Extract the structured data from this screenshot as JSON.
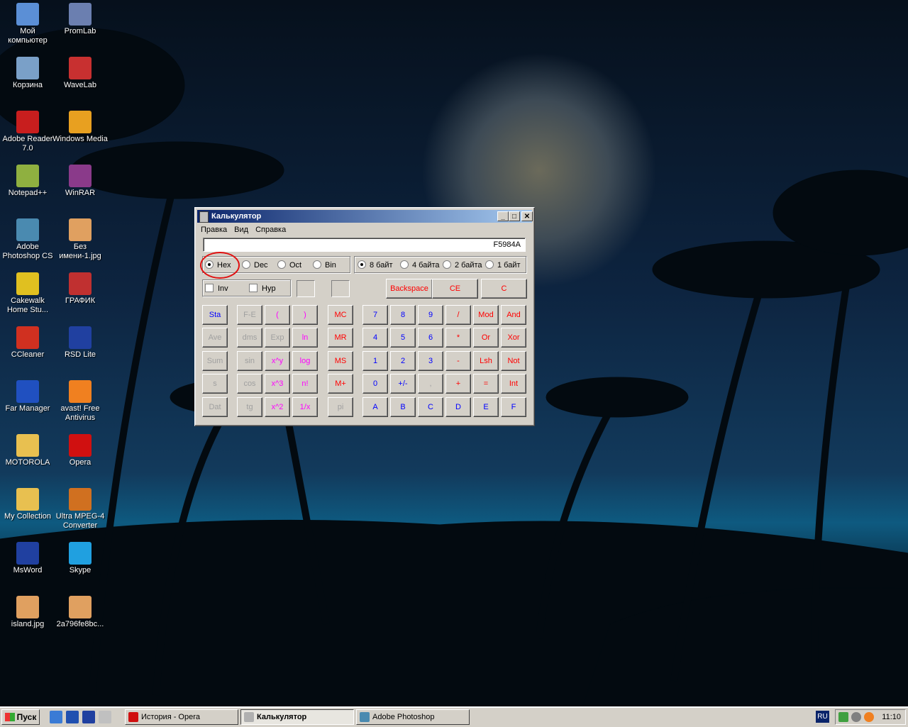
{
  "desktop": {
    "icons": [
      {
        "label": "Мой компьютер",
        "icon": "my-computer-icon",
        "color": "#5b8fd6"
      },
      {
        "label": "PromLab",
        "icon": "promlab-icon",
        "color": "#6b7fb0"
      },
      {
        "label": "Корзина",
        "icon": "recycle-bin-icon",
        "color": "#7aa0c8"
      },
      {
        "label": "WaveLab",
        "icon": "wavelab-icon",
        "color": "#c83030"
      },
      {
        "label": "Adobe Reader 7.0",
        "icon": "adobe-reader-icon",
        "color": "#c81e1e"
      },
      {
        "label": "Windows Media",
        "icon": "windows-media-icon",
        "color": "#e8a020"
      },
      {
        "label": "Notepad++",
        "icon": "notepadpp-icon",
        "color": "#8fb040"
      },
      {
        "label": "WinRAR",
        "icon": "winrar-icon",
        "color": "#8a3a8a"
      },
      {
        "label": "Adobe Photoshop CS",
        "icon": "photoshop-icon",
        "color": "#4a8ab0"
      },
      {
        "label": "Без имени-1.jpg",
        "icon": "jpg-file-icon",
        "color": "#e0a060"
      },
      {
        "label": "Cakewalk Home Stu...",
        "icon": "cakewalk-icon",
        "color": "#e0c020"
      },
      {
        "label": "ГРАФИК",
        "icon": "ms-graph-icon",
        "color": "#c03030"
      },
      {
        "label": "CCleaner",
        "icon": "ccleaner-icon",
        "color": "#d03020"
      },
      {
        "label": "RSD Lite",
        "icon": "rsd-lite-icon",
        "color": "#2040a0"
      },
      {
        "label": "Far Manager",
        "icon": "far-manager-icon",
        "color": "#2050c0"
      },
      {
        "label": "avast! Free Antivirus",
        "icon": "avast-icon",
        "color": "#f08020"
      },
      {
        "label": "MOTOROLA",
        "icon": "folder-icon",
        "color": "#e8c050"
      },
      {
        "label": "Opera",
        "icon": "opera-icon",
        "color": "#d01010"
      },
      {
        "label": "My Collection",
        "icon": "folder-icon",
        "color": "#e8c050"
      },
      {
        "label": "Ultra MPEG-4 Converter",
        "icon": "ultra-mpeg-icon",
        "color": "#d07020"
      },
      {
        "label": "MsWord",
        "icon": "msword-icon",
        "color": "#2040a0"
      },
      {
        "label": "Skype",
        "icon": "skype-icon",
        "color": "#20a0e0"
      },
      {
        "label": "island.jpg",
        "icon": "jpg-file-icon",
        "color": "#e0a060"
      },
      {
        "label": "2a796fe8bc...",
        "icon": "jpg-file-icon",
        "color": "#e0a060"
      }
    ]
  },
  "calculator": {
    "title": "Калькулятор",
    "menu": [
      "Правка",
      "Вид",
      "Справка"
    ],
    "display": "F5984A",
    "bases": [
      {
        "label": "Hex",
        "selected": true
      },
      {
        "label": "Dec",
        "selected": false
      },
      {
        "label": "Oct",
        "selected": false
      },
      {
        "label": "Bin",
        "selected": false
      }
    ],
    "sizes": [
      {
        "label": "8 байт",
        "selected": true
      },
      {
        "label": "4 байта",
        "selected": false
      },
      {
        "label": "2 байта",
        "selected": false
      },
      {
        "label": "1 байт",
        "selected": false
      }
    ],
    "checkboxes": [
      {
        "label": "Inv",
        "checked": false
      },
      {
        "label": "Hyp",
        "checked": false
      }
    ],
    "top_buttons": [
      {
        "label": "Backspace",
        "color": "red"
      },
      {
        "label": "CE",
        "color": "red"
      },
      {
        "label": "C",
        "color": "red"
      }
    ],
    "stat_column": [
      {
        "label": "Sta",
        "color": "blue"
      },
      {
        "label": "Ave",
        "color": "gray"
      },
      {
        "label": "Sum",
        "color": "gray"
      },
      {
        "label": "s",
        "color": "gray"
      },
      {
        "label": "Dat",
        "color": "gray"
      }
    ],
    "sci_col1": [
      {
        "label": "F-E",
        "color": "gray"
      },
      {
        "label": "dms",
        "color": "gray"
      },
      {
        "label": "sin",
        "color": "gray"
      },
      {
        "label": "cos",
        "color": "gray"
      },
      {
        "label": "tg",
        "color": "gray"
      }
    ],
    "sci_col2": [
      {
        "label": "(",
        "color": "mag"
      },
      {
        "label": "Exp",
        "color": "gray"
      },
      {
        "label": "x^y",
        "color": "mag"
      },
      {
        "label": "x^3",
        "color": "mag"
      },
      {
        "label": "x^2",
        "color": "mag"
      }
    ],
    "sci_col3": [
      {
        "label": ")",
        "color": "mag"
      },
      {
        "label": "ln",
        "color": "mag"
      },
      {
        "label": "log",
        "color": "mag"
      },
      {
        "label": "n!",
        "color": "mag"
      },
      {
        "label": "1/x",
        "color": "mag"
      }
    ],
    "memory": [
      {
        "label": "MC",
        "color": "red"
      },
      {
        "label": "MR",
        "color": "red"
      },
      {
        "label": "MS",
        "color": "red"
      },
      {
        "label": "M+",
        "color": "red"
      },
      {
        "label": "pi",
        "color": "gray"
      }
    ],
    "keypad": [
      [
        {
          "label": "7",
          "color": "blue"
        },
        {
          "label": "8",
          "color": "blue"
        },
        {
          "label": "9",
          "color": "blue"
        },
        {
          "label": "/",
          "color": "red"
        },
        {
          "label": "Mod",
          "color": "red"
        },
        {
          "label": "And",
          "color": "red"
        }
      ],
      [
        {
          "label": "4",
          "color": "blue"
        },
        {
          "label": "5",
          "color": "blue"
        },
        {
          "label": "6",
          "color": "blue"
        },
        {
          "label": "*",
          "color": "red"
        },
        {
          "label": "Or",
          "color": "red"
        },
        {
          "label": "Xor",
          "color": "red"
        }
      ],
      [
        {
          "label": "1",
          "color": "blue"
        },
        {
          "label": "2",
          "color": "blue"
        },
        {
          "label": "3",
          "color": "blue"
        },
        {
          "label": "-",
          "color": "red"
        },
        {
          "label": "Lsh",
          "color": "red"
        },
        {
          "label": "Not",
          "color": "red"
        }
      ],
      [
        {
          "label": "0",
          "color": "blue"
        },
        {
          "label": "+/-",
          "color": "blue"
        },
        {
          "label": ",",
          "color": "gray"
        },
        {
          "label": "+",
          "color": "red"
        },
        {
          "label": "=",
          "color": "red"
        },
        {
          "label": "Int",
          "color": "red"
        }
      ],
      [
        {
          "label": "A",
          "color": "blue"
        },
        {
          "label": "B",
          "color": "blue"
        },
        {
          "label": "C",
          "color": "blue"
        },
        {
          "label": "D",
          "color": "blue"
        },
        {
          "label": "E",
          "color": "blue"
        },
        {
          "label": "F",
          "color": "blue"
        }
      ]
    ]
  },
  "taskbar": {
    "start_label": "Пуск",
    "tasks": [
      {
        "label": "История - Opera",
        "icon": "opera-icon",
        "active": false
      },
      {
        "label": "Калькулятор",
        "icon": "calculator-icon",
        "active": true
      },
      {
        "label": "Adobe Photoshop",
        "icon": "photoshop-icon",
        "active": false
      }
    ],
    "language": "RU",
    "clock": "11:10"
  }
}
